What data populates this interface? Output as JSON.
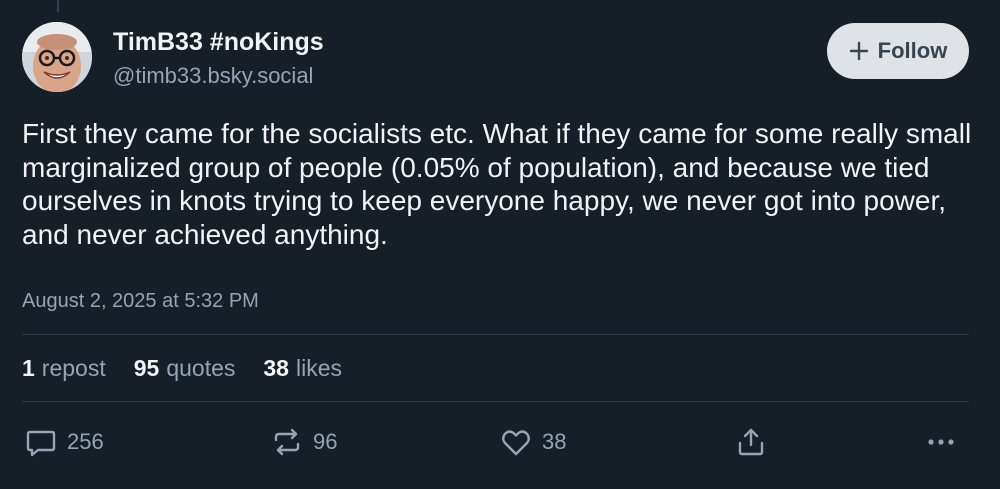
{
  "author": {
    "display_name": "TimB33 #noKings",
    "handle": "@timb33.bsky.social",
    "avatar_icon": "avatar-photo"
  },
  "follow_button": {
    "label": "Follow",
    "icon": "plus-icon"
  },
  "post": {
    "text": "First they came for the socialists etc. What if they came for some really small marginalized group of people (0.05% of population), and because we tied ourselves in knots trying to keep everyone happy, we never got into power, and never achieved anything.",
    "timestamp": "August 2, 2025 at 5:32 PM"
  },
  "stats": {
    "reposts_count": "1",
    "reposts_label": "repost",
    "quotes_count": "95",
    "quotes_label": "quotes",
    "likes_count": "38",
    "likes_label": "likes"
  },
  "actions": {
    "reply": {
      "icon": "speech-bubble-icon",
      "count": "256"
    },
    "repost": {
      "icon": "repost-arrows-icon",
      "count": "96"
    },
    "like": {
      "icon": "heart-icon",
      "count": "38"
    },
    "share": {
      "icon": "share-icon"
    },
    "more": {
      "icon": "ellipsis-icon"
    }
  },
  "colors": {
    "background": "#161e27",
    "primary_text": "#f1f3f5",
    "secondary_text": "#93a5b7",
    "follow_button_bg": "#dfe3e8",
    "divider": "#2e3b48"
  }
}
